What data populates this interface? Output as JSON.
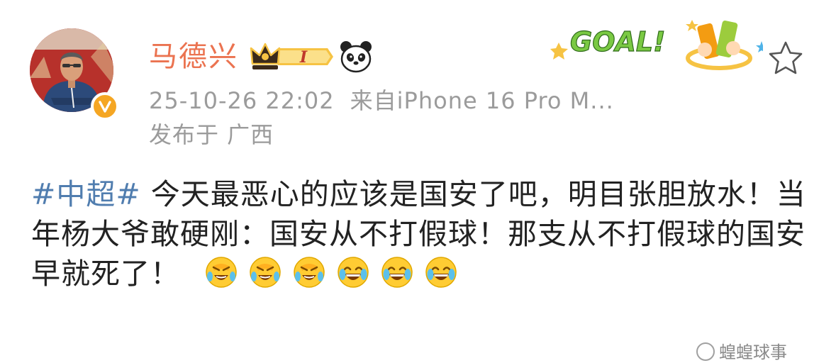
{
  "post": {
    "author": {
      "name": "马德兴",
      "avatar": "avatar-photo",
      "verified_icon": "verified-v-icon",
      "vip_badge": {
        "icon": "crown-icon",
        "level": "I"
      },
      "extra_badge_icon": "panda-icon"
    },
    "time": "25-10-26 22:02",
    "source": "来自iPhone 16 Pro M...",
    "location": "发布于 广西",
    "decoration": {
      "sticker_text": "GOAL!",
      "sticker_icon": "goal-sticker-icon"
    },
    "favorite_icon": "star-outline-icon",
    "content": {
      "hashtag": "#中超#",
      "text": " 今天最恶心的应该是国安了吧，明目张胆放水！当年杨大爷敢硬刚：国安从不打假球！那支从不打假球的国安早就死了！",
      "emojis": [
        "facepalm-laugh-icon",
        "facepalm-laugh-icon",
        "facepalm-laugh-icon",
        "tears-of-joy-icon",
        "tears-of-joy-icon",
        "tears-of-joy-icon"
      ]
    },
    "watermark": "蝗蝗球事"
  },
  "colors": {
    "username": "#eb7350",
    "hashtag": "#507daf",
    "meta": "#9b9b9b",
    "text": "#222222",
    "verified": "#f5a623",
    "emoji_yellow": "#ffcc33"
  }
}
